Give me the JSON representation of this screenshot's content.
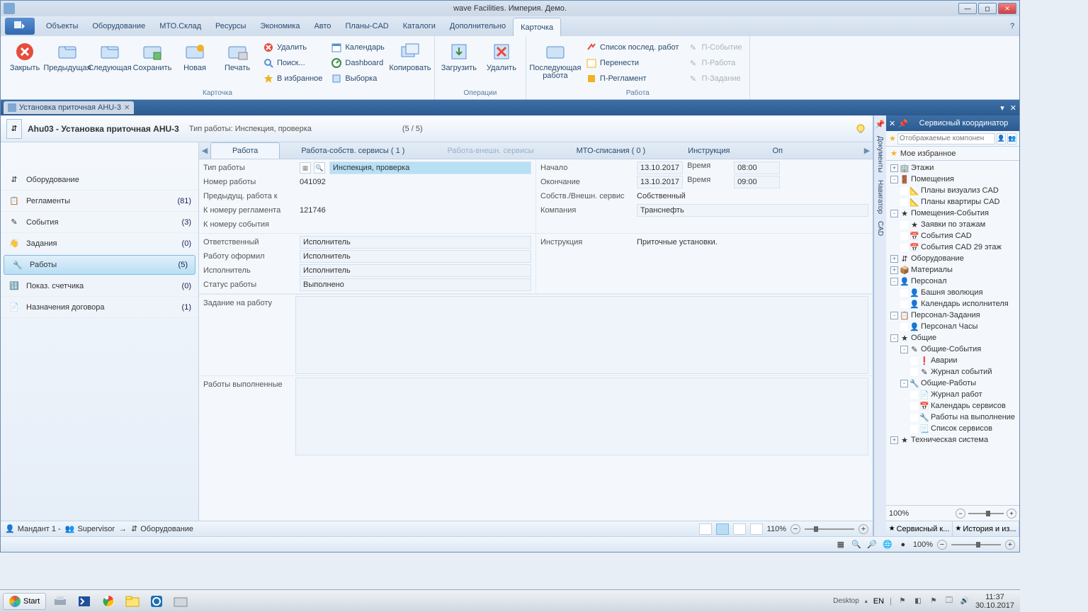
{
  "title": "wave Facilities. Империя. Демо.",
  "menu": [
    "Объекты",
    "Оборудование",
    "МТО.Склад",
    "Ресурсы",
    "Экономика",
    "Авто",
    "Планы-CAD",
    "Каталоги",
    "Дополнительно",
    "Карточка"
  ],
  "ribbon": {
    "card": {
      "label": "Карточка",
      "close": "Закрыть",
      "prev": "Предыдущая",
      "next": "Следующая",
      "save": "Сохранить",
      "new": "Новая",
      "print": "Печать",
      "delete": "Удалить",
      "search": "Поиск...",
      "fav": "В избранное",
      "calendar": "Календарь",
      "dashboard": "Dashboard",
      "selection": "Выборка"
    },
    "copy": "Копировать",
    "ops": {
      "label": "Операции",
      "load": "Загрузить",
      "del": "Удалить"
    },
    "work": {
      "label": "Работа",
      "last": "Последующая работа",
      "list": "Список послед. работ",
      "move": "Перенести",
      "reg": "П-Регламент",
      "pevent": "П-Событие",
      "pwork": "П-Работа",
      "ptask": "П-Задание"
    }
  },
  "docTab": "Установка приточная AHU-3",
  "header": {
    "code": "Ahu03 - Установка приточная AHU-3",
    "typelabel": "Тип работы:",
    "type": "Инспекция, проверка",
    "counter": "(5 / 5)"
  },
  "side": [
    {
      "label": "Оборудование",
      "count": ""
    },
    {
      "label": "Регламенты",
      "count": "(81)"
    },
    {
      "label": "События",
      "count": "(3)"
    },
    {
      "label": "Задания",
      "count": "(0)"
    },
    {
      "label": "Работы",
      "count": "(5)"
    },
    {
      "label": "Показ. счетчика",
      "count": "(0)"
    },
    {
      "label": "Назначения договора",
      "count": "(1)"
    }
  ],
  "dtabs": [
    "Работа",
    "Работа-собств. сервисы ( 1 )",
    "Работа-внешн. сервисы",
    "МТО-списания ( 0 )",
    "Инструкция",
    "Оп"
  ],
  "form": {
    "l": {
      "type": "Тип работы",
      "typeval": "Инспекция, проверка",
      "num": "Номер работы",
      "numval": "041092",
      "prev": "Предыдущ. работа к",
      "reg": "К номеру регламента",
      "regval": "121746",
      "evt": "К номеру события",
      "resp": "Ответственный",
      "respval": "Исполнитель",
      "issued": "Работу оформил",
      "issuedval": "Исполнитель",
      "exec": "Исполнитель",
      "execval": "Исполнитель",
      "status": "Статус работы",
      "statusval": "Выполнено"
    },
    "r": {
      "start": "Начало",
      "startval": "13.10.2017",
      "time": "Время",
      "starttime": "08:00",
      "end": "Окончание",
      "endval": "13.10.2017",
      "endtime": "09:00",
      "serv": "Собств./Внешн. сервис",
      "servval": "Собственный",
      "comp": "Компания",
      "compval": "Транснефть",
      "instr": "Инструкция",
      "instrval": "Приточные установки."
    },
    "task": "Задание на работу",
    "done": "Работы выполненные"
  },
  "vnav": [
    "Документы",
    "Навигатор",
    "CAD"
  ],
  "rpanel": {
    "title": "Сервисный координатор",
    "placeholder": "Отображаемые компонен",
    "fav": "Мое избранное",
    "tree": [
      {
        "d": 0,
        "t": "+",
        "i": "fl",
        "l": "Этажи"
      },
      {
        "d": 0,
        "t": "-",
        "i": "rm",
        "l": "Помещения"
      },
      {
        "d": 1,
        "t": " ",
        "i": "cad",
        "l": "Планы визуализ CAD"
      },
      {
        "d": 1,
        "t": " ",
        "i": "cad",
        "l": "Планы квартиры CAD"
      },
      {
        "d": 0,
        "t": "-",
        "i": "star",
        "l": "Помещения-События"
      },
      {
        "d": 1,
        "t": " ",
        "i": "star",
        "l": "Заявки по этажам"
      },
      {
        "d": 1,
        "t": " ",
        "i": "cal",
        "l": "События CAD"
      },
      {
        "d": 1,
        "t": " ",
        "i": "cal",
        "l": "События CAD 29 этаж"
      },
      {
        "d": 0,
        "t": "+",
        "i": "eq",
        "l": "Оборудование"
      },
      {
        "d": 0,
        "t": "+",
        "i": "mat",
        "l": "Материалы"
      },
      {
        "d": 0,
        "t": "-",
        "i": "per",
        "l": "Персонал"
      },
      {
        "d": 1,
        "t": " ",
        "i": "per",
        "l": "Башня эволюция"
      },
      {
        "d": 1,
        "t": " ",
        "i": "per",
        "l": "Календарь исполнителя"
      },
      {
        "d": 0,
        "t": "-",
        "i": "task",
        "l": "Персонал-Задания"
      },
      {
        "d": 1,
        "t": " ",
        "i": "per",
        "l": "Персонал Часы"
      },
      {
        "d": 0,
        "t": "-",
        "i": "star",
        "l": "Общие"
      },
      {
        "d": 1,
        "t": "-",
        "i": "evt",
        "l": "Общие-События"
      },
      {
        "d": 2,
        "t": " ",
        "i": "alert",
        "l": "Аварии"
      },
      {
        "d": 2,
        "t": " ",
        "i": "evt",
        "l": "Журнал событий"
      },
      {
        "d": 1,
        "t": "-",
        "i": "work",
        "l": "Общие-Работы"
      },
      {
        "d": 2,
        "t": " ",
        "i": "log",
        "l": "Журнал работ"
      },
      {
        "d": 2,
        "t": " ",
        "i": "cal",
        "l": "Календарь сервисов"
      },
      {
        "d": 2,
        "t": " ",
        "i": "work",
        "l": "Работы на выполнение"
      },
      {
        "d": 2,
        "t": " ",
        "i": "list",
        "l": "Список сервисов"
      },
      {
        "d": 0,
        "t": "+",
        "i": "star",
        "l": "Техническая система"
      }
    ],
    "zoom": "100%",
    "tabs": [
      "Сервисный к...",
      "История и из..."
    ]
  },
  "status1": {
    "mandant": "Мандант 1 -",
    "user": "Supervisor",
    "equip": "Оборудование",
    "zoom": "110%"
  },
  "status2": {
    "zoom": "100%"
  },
  "taskbar": {
    "start": "Start",
    "desktop": "Desktop",
    "lang": "EN",
    "time": "11:37",
    "date": "30.10.2017"
  }
}
